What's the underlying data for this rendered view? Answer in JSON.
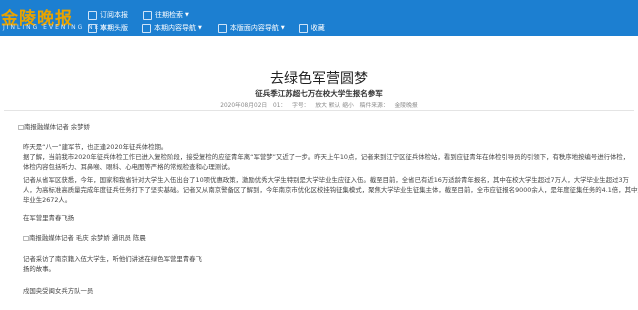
{
  "header": {
    "logo_title": "金陵晚报",
    "logo_pinyin": "JINLING EVENING NEWS",
    "nav_row1": [
      {
        "label": "订阅本报",
        "icon": "subscribe-icon",
        "has_dropdown": false
      },
      {
        "label": "往期检索",
        "icon": "archive-icon",
        "has_dropdown": true
      }
    ],
    "nav_row2": [
      {
        "label": "本期头版",
        "icon": "front-page-icon",
        "has_dropdown": false
      },
      {
        "label": "本期内容导航",
        "icon": "content-nav-icon",
        "has_dropdown": true
      },
      {
        "label": "本版面内容导航",
        "icon": "page-nav-icon",
        "has_dropdown": true
      },
      {
        "label": "收藏",
        "icon": "favorite-icon",
        "has_dropdown": false
      }
    ],
    "colors": {
      "bar": "#1c7fd1",
      "logo": "#e8a300"
    }
  },
  "article": {
    "title": "去绿色军营圆梦",
    "subtitle": "征兵季江苏超七万在校大学生报名参军",
    "meta": {
      "date": "2020年08月02日",
      "page": "01：",
      "font_size_label": "字号：",
      "font_options": "放大 默认 缩小",
      "source_label": "稿件来源：",
      "source": "金陵晚报"
    },
    "paragraphs": [
      "□南报融媒体记者   余梦娇",
      "昨天是“八一”建军节，也正逢2020年征兵体检期。",
      "据了解，当前我市2020年征兵体检工作已进入复检阶段，接受复检的应征青年离“军营梦”又近了一步。昨天上午10点，记者来到江宁区征兵体检站，看到应征青年在体检引导员的引领下，有秩序地按编号进行体检，",
      "体检内容包括听力、耳鼻喉、眼科、心电图等严格的常规检查和心理测试。",
      "记者从省军区获悉，今年，国家和我省针对大学生入伍出台了10项优惠政策，激励优秀大学生特别是大学毕业生应征入伍。截至目前，全省已有近16万适龄青年报名，其中在校大学生超过7万人，大学毕业生超过3万",
      "人，为高标准高质量完成年度征兵任务打下了坚实基础。记者又从南京警备区了解到，今年南京市优化区校挂钩征集模式，聚焦大学毕业生征集主体，截至目前，全市应征报名9000余人，是年度征集任务的4.1倍，其中大学",
      "毕业生2672人。",
      "在军营里青春飞扬",
      "□南报融媒体记者   毛庆   余梦娇   通讯员   陈晨",
      "记者采访了南京籍入伍大学生，听他们讲述在绿色军营里青春飞",
      "扬的故事。",
      "戍国央受闽女兵方队一员"
    ]
  }
}
